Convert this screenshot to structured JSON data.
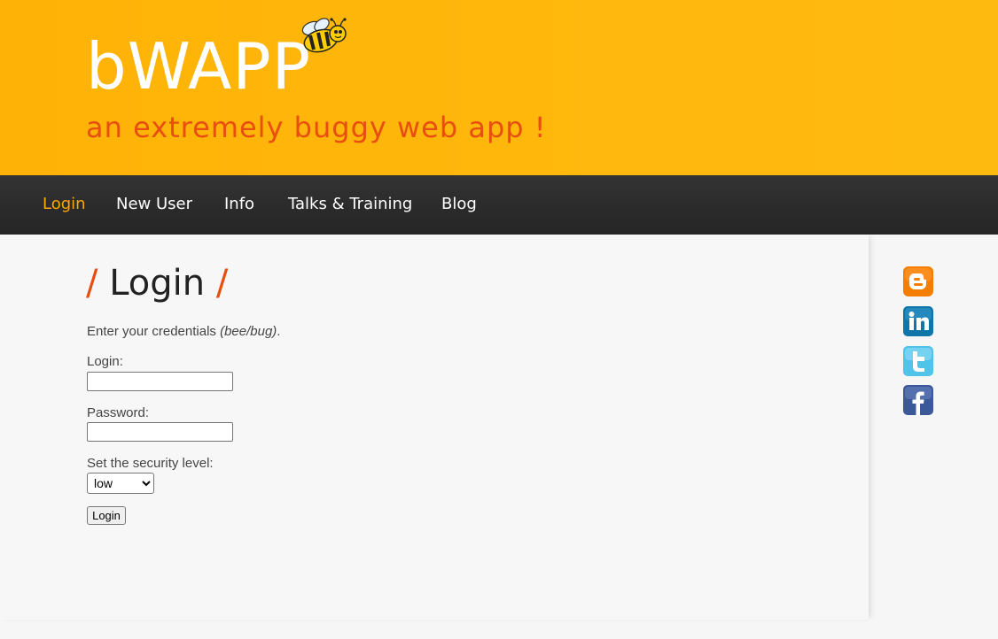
{
  "header": {
    "logo": "bWAPP",
    "tagline": "an extremely buggy web app !"
  },
  "nav": {
    "items": [
      {
        "label": "Login",
        "active": true
      },
      {
        "label": "New User"
      },
      {
        "label": "Info"
      },
      {
        "label": "Talks & Training"
      },
      {
        "label": "Blog"
      }
    ]
  },
  "main": {
    "title": "Login",
    "title_slash": "/",
    "intro_text": "Enter your credentials ",
    "intro_hint": "(bee/bug)",
    "intro_end": ".",
    "login_label": "Login:",
    "login_value": "",
    "password_label": "Password:",
    "password_value": "",
    "security_label": "Set the security level:",
    "security_selected": "low",
    "submit_label": "Login"
  },
  "social": {
    "icons": [
      "blogger-icon",
      "linkedin-icon",
      "twitter-icon",
      "facebook-icon"
    ]
  },
  "colors": {
    "header_bg": "#ffb70c",
    "accent_orange": "#e84e10",
    "nav_active": "#ffa500",
    "nav_bg": "#2e2e2e"
  }
}
